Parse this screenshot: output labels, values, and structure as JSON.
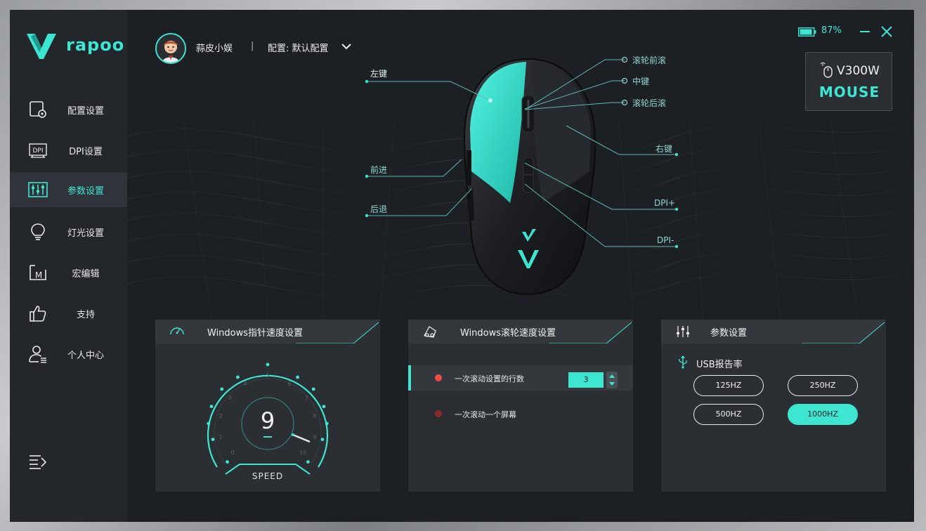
{
  "brand": {
    "name": "rapoo"
  },
  "sidebar": {
    "items": [
      {
        "label": "配置设置",
        "icon": "profile-settings-icon"
      },
      {
        "label": "DPI设置",
        "icon": "dpi-icon"
      },
      {
        "label": "参数设置",
        "icon": "sliders-icon",
        "active": true
      },
      {
        "label": "灯光设置",
        "icon": "lightbulb-icon"
      },
      {
        "label": "宏编辑",
        "icon": "macro-icon"
      },
      {
        "label": "支持",
        "icon": "thumbs-up-icon"
      },
      {
        "label": "个人中心",
        "icon": "user-icon"
      }
    ],
    "dpi_icon_text": "DPI",
    "macro_icon_text": "M"
  },
  "header": {
    "username": "蒜皮小娱",
    "separator": "|",
    "profile": "配置: 默认配置",
    "battery": "87%"
  },
  "device": {
    "model": "V300W",
    "type": "MOUSE"
  },
  "mouse_labels": {
    "left": "左键",
    "forward": "前进",
    "back": "后退",
    "scroll_up": "滚轮前滚",
    "middle": "中键",
    "scroll_down": "滚轮后滚",
    "right": "右键",
    "dpi_plus": "DPI+",
    "dpi_minus": "DPI-"
  },
  "pointer_card": {
    "title": "Windows指针速度设置",
    "value": "9",
    "label": "SPEED",
    "ticks": [
      "0",
      "1",
      "2",
      "3",
      "4",
      "5",
      "6",
      "7",
      "8",
      "9",
      "10"
    ]
  },
  "scroll_card": {
    "title": "Windows滚轮速度设置",
    "option_lines": "一次滚动设置的行数",
    "option_lines_value": "3",
    "option_screen": "一次滚动一个屏幕"
  },
  "params_card": {
    "title": "参数设置",
    "usb_label": "USB报告率",
    "rates": [
      "125HZ",
      "250HZ",
      "500HZ",
      "1000HZ"
    ],
    "selected_rate": "1000HZ"
  },
  "colors": {
    "accent": "#3ee6d2",
    "active_dot": "#ee4b4b",
    "inactive_dot": "#8a2c2c"
  }
}
